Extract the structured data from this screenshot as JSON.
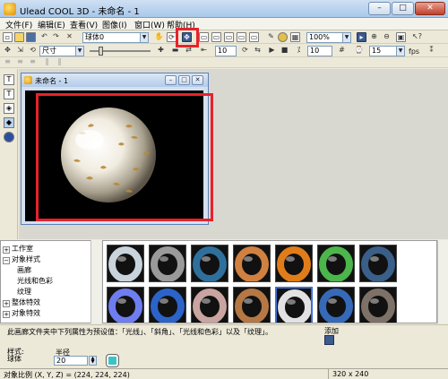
{
  "window": {
    "title": "Ulead COOL 3D - 未命名 - 1",
    "min_glyph": "–",
    "max_glyph": "□",
    "close_glyph": "✕"
  },
  "menu": [
    {
      "label": "文件(F)"
    },
    {
      "label": "编辑(E)"
    },
    {
      "label": "查看(V)"
    },
    {
      "label": "图像(I)"
    },
    {
      "label": "窗口(W)"
    },
    {
      "label": "帮助(H)"
    }
  ],
  "toolbar1": {
    "object_select": "球体0",
    "zoom_select": "100%"
  },
  "toolbar2": {
    "size_select": "尺寸",
    "frame_value": "10",
    "frame_value_2": "10",
    "fps_value": "15",
    "fps_label": "fps"
  },
  "document": {
    "title": "未命名 - 1"
  },
  "tree": {
    "items": [
      {
        "label": "工作室",
        "expander": "+",
        "level": 0
      },
      {
        "label": "对象样式",
        "expander": "−",
        "level": 0
      },
      {
        "label": "画廊",
        "expander": "",
        "level": 1
      },
      {
        "label": "光线和色彩",
        "expander": "",
        "level": 1
      },
      {
        "label": "纹理",
        "expander": "",
        "level": 1
      },
      {
        "label": "整体特效",
        "expander": "+",
        "level": 0
      },
      {
        "label": "对象特效",
        "expander": "+",
        "level": 0
      }
    ]
  },
  "gallery": {
    "thumbnails": [
      {
        "name": "ring-chrome",
        "color": "#c9d3dc"
      },
      {
        "name": "ring-stone",
        "color": "#9a9a9a"
      },
      {
        "name": "ring-blue-marble",
        "color": "#2f6f9c"
      },
      {
        "name": "ring-copper",
        "color": "#d08040"
      },
      {
        "name": "ring-orange",
        "color": "#e07d1a"
      },
      {
        "name": "ring-green",
        "color": "#4bb64b"
      },
      {
        "name": "ring-dark-blue",
        "color": "#3a5f88"
      },
      {
        "name": "ring-purple",
        "color": "#6e7df0"
      },
      {
        "name": "ring-sapphire",
        "color": "#2b63c8"
      },
      {
        "name": "ring-pink-marble",
        "color": "#c9a4a0"
      },
      {
        "name": "ring-wood",
        "color": "#b57744"
      },
      {
        "name": "ring-white",
        "color": "#e2e2e2"
      },
      {
        "name": "ring-cobalt",
        "color": "#3669b8"
      },
      {
        "name": "ring-granite",
        "color": "#7e7268"
      }
    ]
  },
  "info": {
    "description": "此画廊文件夹中下列属性为预设值：「光线」、「斜角」、「光线和色彩」以及「纹理」。",
    "add_label": "添加",
    "style_label": "样式:",
    "style_value": "球体",
    "radius_label": "半径",
    "radius_value": "20",
    "swatch_color": "#3bc4c4"
  },
  "status": {
    "text": "对象比例 (X, Y, Z) = (224, 224, 224)",
    "size": "320 x 240"
  },
  "colors": {
    "highlight": "#e8222b",
    "selection": "#3d6fd6"
  }
}
